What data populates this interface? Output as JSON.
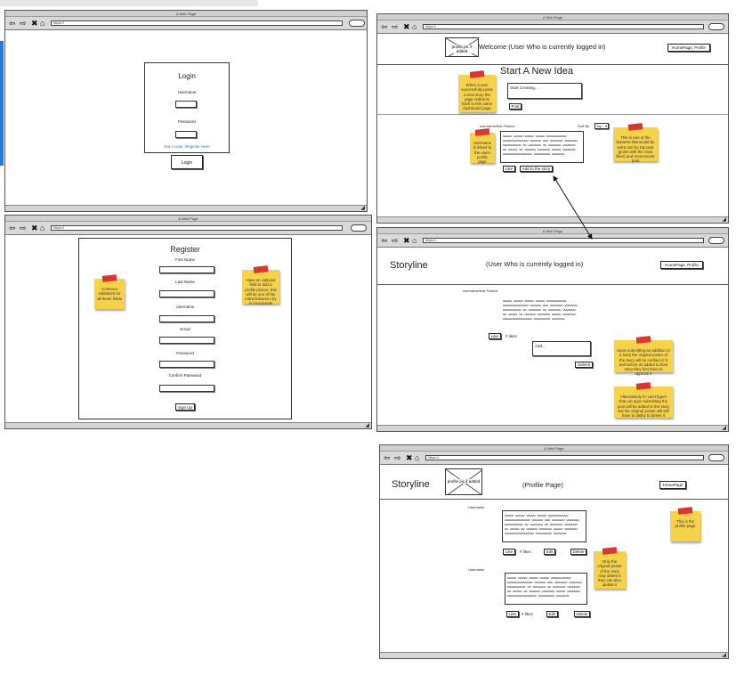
{
  "common": {
    "window_title": "A Web Page",
    "url": "https://"
  },
  "login": {
    "title": "Login",
    "username_label": "Username",
    "password_label": "Password",
    "register_link": "Not A User, Register Here",
    "login_button": "Login"
  },
  "register": {
    "title": "Register",
    "first_name": "First Name",
    "last_name": "Last Name",
    "username": "Username",
    "email": "Email",
    "password": "Password",
    "confirm_password": "Confirm Password",
    "signup_button": "Sign Up",
    "note_validators": "Common validators for all these fields",
    "note_profile_picture": "Have an optional field to add a profile picture, this will be one of the extra features I try to incorporate"
  },
  "dashboard": {
    "profile_pic": "profile pic if added",
    "welcome": "Welcome (User Who is currently logged in)",
    "homepage_profile_button": "HomePage, Profile",
    "heading": "Start A New Idea",
    "textarea_placeholder": "Start Creating...",
    "post_button": "Post",
    "posted_label": "username/first Posted",
    "sort_label": "Sort By",
    "sort_value": "Top",
    "story_text": "wwwww wwwww wwwww wwwww wwwwwwwwwww\nwwwwwwwwwwwwww wwwwww www wwwwwww wwwwwww\nwwwwwwwwww ww wwwwwww ww wwwwwww wwwwwww\nww wwwww ww wwwwww wwwwwww wwwww wwwwwww\nwwwwwwwwwwwwwwww wwwwwwwww wwwwwww",
    "like_button": "Like",
    "add_story_button": "Add to the story",
    "note_redirect": "When a user successfully posts a new story the page redirects back to this same dashboard page",
    "note_username": "Username is linked to the users profile page",
    "note_sort": "This is one of the features that would be extra sort by top post (posts with the most likes) and most recent post"
  },
  "storyline": {
    "brand": "Storyline",
    "user_title": "(User Who is currently logged in)",
    "homepage_profile_button": "HomePage, Profile",
    "posted_label": "username/first Posted",
    "like_button": "Like",
    "likes_count": "# likes",
    "add_placeholder": "Add...",
    "submit_button": "Submit",
    "note_submit": "Upon submitting an addition to a story the original poster of the story will be notified of it and before its added to their story they first have to approve it",
    "note_alternative": "Alternatively if I can't figure that out upon submitting the post will be added to the story but the original poster will still have to ability to delete it"
  },
  "profile": {
    "brand": "Storyline",
    "profile_pic": "profile pic if added",
    "title": "(Profile Page)",
    "homepage_button": "HomePage",
    "username_label": "Username",
    "like_button": "Like",
    "likes_count": "# likes",
    "edit_button": "Edit",
    "delete_button": "Delete",
    "note_profile": "This is the profile page",
    "note_owner": "Only the original poster of the story may delete it they can also update it"
  }
}
